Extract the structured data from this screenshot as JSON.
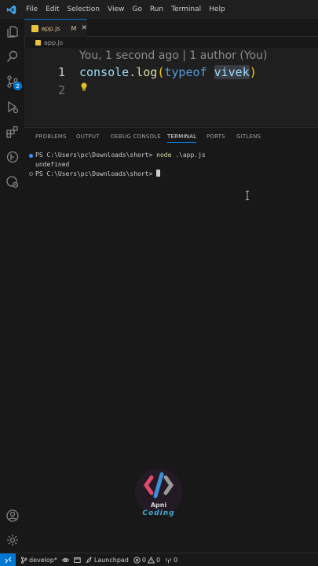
{
  "menu": [
    "File",
    "Edit",
    "Selection",
    "View",
    "Go",
    "Run",
    "Terminal",
    "Help"
  ],
  "activity_bar": {
    "icons": [
      "explorer-icon",
      "search-icon",
      "source-control-icon",
      "run-debug-icon",
      "extensions-icon",
      "gitlens-icon",
      "remote-explorer-icon"
    ],
    "scm_badge": "2",
    "bottom_icons": [
      "account-icon",
      "settings-gear-icon"
    ]
  },
  "tab": {
    "label": "app.js",
    "modified": "M",
    "close": "✕"
  },
  "breadcrumb": {
    "file": "app.js"
  },
  "editor": {
    "blame": "You, 1 second ago | 1 author (You)",
    "line_numbers": [
      "1",
      "2"
    ],
    "code": {
      "obj": "console",
      "dot": ".",
      "method": "log",
      "open": "(",
      "keyword": "typeof",
      "space": " ",
      "ident": "vivek",
      "close": ")"
    }
  },
  "panel": {
    "tabs": [
      "PROBLEMS",
      "OUTPUT",
      "DEBUG CONSOLE",
      "TERMINAL",
      "PORTS",
      "GITLENS"
    ],
    "active_tab": "TERMINAL",
    "terminal": {
      "line1_prompt": "PS C:\\Users\\pc\\Downloads\\short> ",
      "line1_cmd": "node",
      "line1_arg": " .\\app.js",
      "line2": "undefined",
      "line3_prompt": "PS C:\\Users\\pc\\Downloads\\short> "
    }
  },
  "watermark": {
    "line1": "Apni",
    "line2": "Coding"
  },
  "statusbar": {
    "branch": "develop*",
    "launchpad": "Launchpad",
    "errors": "0",
    "warnings": "0",
    "ports": "0"
  },
  "colors": {
    "accent": "#0078d4",
    "js_icon": "#e8c33c"
  }
}
